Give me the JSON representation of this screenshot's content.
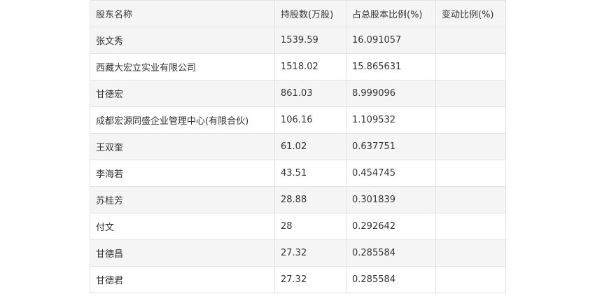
{
  "table": {
    "headers": [
      "股东名称",
      "持股数(万股)",
      "占总股本比例(%)",
      "变动比例(%)"
    ],
    "rows": [
      [
        "张文秀",
        "1539.59",
        "16.091057",
        ""
      ],
      [
        "西藏大宏立实业有限公司",
        "1518.02",
        "15.865631",
        ""
      ],
      [
        "甘德宏",
        "861.03",
        "8.999096",
        ""
      ],
      [
        "成都宏源同盛企业管理中心(有限合伙)",
        "106.16",
        "1.109532",
        ""
      ],
      [
        "王双奎",
        "61.02",
        "0.637751",
        ""
      ],
      [
        "李海若",
        "43.51",
        "0.454745",
        ""
      ],
      [
        "苏桂芳",
        "28.88",
        "0.301839",
        ""
      ],
      [
        "付文",
        "28",
        "0.292642",
        ""
      ],
      [
        "甘德昌",
        "27.32",
        "0.285584",
        ""
      ],
      [
        "甘德君",
        "27.32",
        "0.285584",
        ""
      ]
    ]
  }
}
